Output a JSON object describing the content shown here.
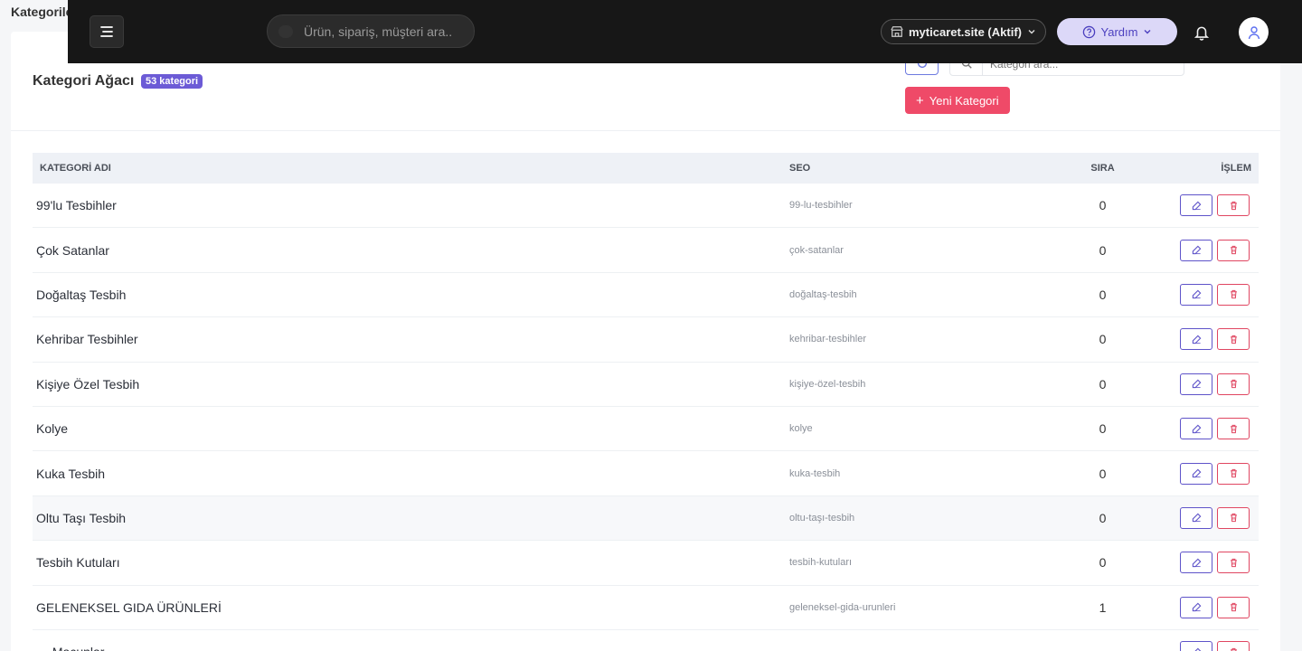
{
  "page": {
    "heading": "Kategorile"
  },
  "topbar": {
    "search_placeholder": "Ürün, sipariş, müşteri ara..",
    "store_label": "myticaret.site (Aktif)",
    "help_label": "Yardım"
  },
  "card": {
    "title": "Kategori Ağacı",
    "count_badge": "53 kategori",
    "search_placeholder": "Kategori ara...",
    "new_button": "Yeni Kategori"
  },
  "table": {
    "columns": {
      "name": "KATEGORİ ADI",
      "seo": "SEO",
      "sira": "SIRA",
      "islem": "İŞLEM"
    },
    "rows": [
      {
        "name": "99'lu Tesbihler",
        "seo": "99-lu-tesbihler",
        "sira": "0"
      },
      {
        "name": "Çok Satanlar",
        "seo": "çok-satanlar",
        "sira": "0"
      },
      {
        "name": "Doğaltaş Tesbih",
        "seo": "doğaltaş-tesbih",
        "sira": "0"
      },
      {
        "name": "Kehribar Tesbihler",
        "seo": "kehribar-tesbihler",
        "sira": "0"
      },
      {
        "name": "Kişiye Özel Tesbih",
        "seo": "kişiye-özel-tesbih",
        "sira": "0"
      },
      {
        "name": "Kolye",
        "seo": "kolye",
        "sira": "0"
      },
      {
        "name": "Kuka Tesbih",
        "seo": "kuka-tesbih",
        "sira": "0"
      },
      {
        "name": "Oltu Taşı Tesbih",
        "seo": "oltu-taşı-tesbih",
        "sira": "0"
      },
      {
        "name": "Tesbih Kutuları",
        "seo": "tesbih-kutuları",
        "sira": "0"
      },
      {
        "name": "GELENEKSEL GIDA ÜRÜNLERİ",
        "seo": "geleneksel-gida-urunleri",
        "sira": "1"
      },
      {
        "name": "— Macunlar",
        "seo": "",
        "sira": ""
      }
    ]
  },
  "colors": {
    "accent": "#6c5bd6",
    "danger": "#ef4a68",
    "topbar": "#171717"
  },
  "icons": {
    "menu": "hamburger-icon",
    "store": "store-icon",
    "help": "question-circle-icon",
    "bell": "bell-icon",
    "user": "user-icon",
    "edit": "edit-icon",
    "delete": "trash-icon",
    "refresh": "refresh-icon",
    "search": "search-icon"
  }
}
